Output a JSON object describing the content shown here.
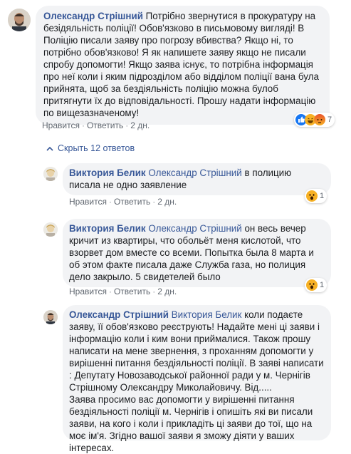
{
  "comment1": {
    "author": "Олександр Стрішний",
    "text": "Потрібно звернутися в прокуратуру на безідяльність поліції! Обов'язково в письмовому вигляді! В Поліцію писали заяву про погрозу вбивства? Якщо ні, то потрібно обов'язково! Я як напишете заяву якщо не писали спробу допомогти! Якщо заява існує, то потрібна інформація про неї коли і яким підрозділом або відділом поліції вана була прийнята, щоб за бездіяльність поліцію можна булоб притягнути їх до відповідальності. Прошу надати інформацію по вищезазначеному!",
    "reactions_count": "7",
    "actions": {
      "like": "Нравится",
      "reply": "Ответить",
      "time": "2 дн."
    }
  },
  "hide_replies_label": "Скрыть 12 ответов",
  "replies": [
    {
      "author": "Виктория Белик",
      "mention": "Олександр Стрішний",
      "text": "в полицию писала не одно заявление",
      "reactions_count": "1",
      "actions": {
        "like": "Нравится",
        "reply": "Ответить",
        "time": "2 дн."
      }
    },
    {
      "author": "Виктория Белик",
      "mention": "Олександр Стрішний",
      "text": "он весь вечер кричит из квартиры, что обольёт меня кислотой, что взорвет дом вместе со всеми. Попытка была 8 марта и об этом факте писала даже Служба газа, но полиция дело закрыло. 5 свидетелей было",
      "reactions_count": "1",
      "actions": {
        "like": "Нравится",
        "reply": "Ответить",
        "time": "2 дн."
      }
    },
    {
      "author": "Олександр Стрішний",
      "mention": "Виктория Белик",
      "text": "коли подаєте заяву, її обов'язково реєструють! Надайте мені ці заяви і інформацію коли і ким вони приймалися. Також прошу написати на мене звернення, з проханням допомогти у вирішенні питання бездіяльності поліції. В заяві написати : Депутату Новозаводської районної ради у м. Чернігів Стрішному Олександру Миколайовичу. Від.....",
      "text2": "Заява просимо вас допомогти у вирішенні питання бездіяльності поліції м. Чернігів і опишіть які ви писали заяви, на кого і коли і прикладіть ці заяви до тої, що на моє ім'я. Згідно вашої заяви я зможу діяти у ваших інтересах."
    }
  ],
  "colors": {
    "link": "#385898",
    "bubble": "#f2f3f5",
    "meta": "#606770"
  }
}
